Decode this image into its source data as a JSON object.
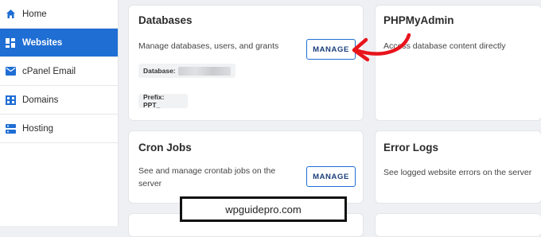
{
  "sidebar": {
    "items": [
      {
        "label": "Home",
        "icon": "home-icon",
        "active": false
      },
      {
        "label": "Websites",
        "icon": "websites-grid-icon",
        "active": true
      },
      {
        "label": "cPanel Email",
        "icon": "mail-icon",
        "active": false
      },
      {
        "label": "Domains",
        "icon": "domains-icon",
        "active": false
      },
      {
        "label": "Hosting",
        "icon": "server-icon",
        "active": false
      }
    ]
  },
  "cards": {
    "databases": {
      "title": "Databases",
      "description": "Manage databases, users, and grants",
      "button": "MANAGE",
      "database_label": "Database:",
      "prefix_label": "Prefix: PPT_"
    },
    "phpmyadmin": {
      "title": "PHPMyAdmin",
      "description": "Access database content directly"
    },
    "cron": {
      "title": "Cron Jobs",
      "description_line1": "See and manage crontab jobs on the",
      "description_line2": "server",
      "button": "MANAGE"
    },
    "errorlogs": {
      "title": "Error Logs",
      "description": "See logged website errors on the server"
    }
  },
  "watermark": "wpguidepro.com",
  "colors": {
    "accent": "#1f6ed4",
    "annotation_arrow": "#e8141c"
  }
}
